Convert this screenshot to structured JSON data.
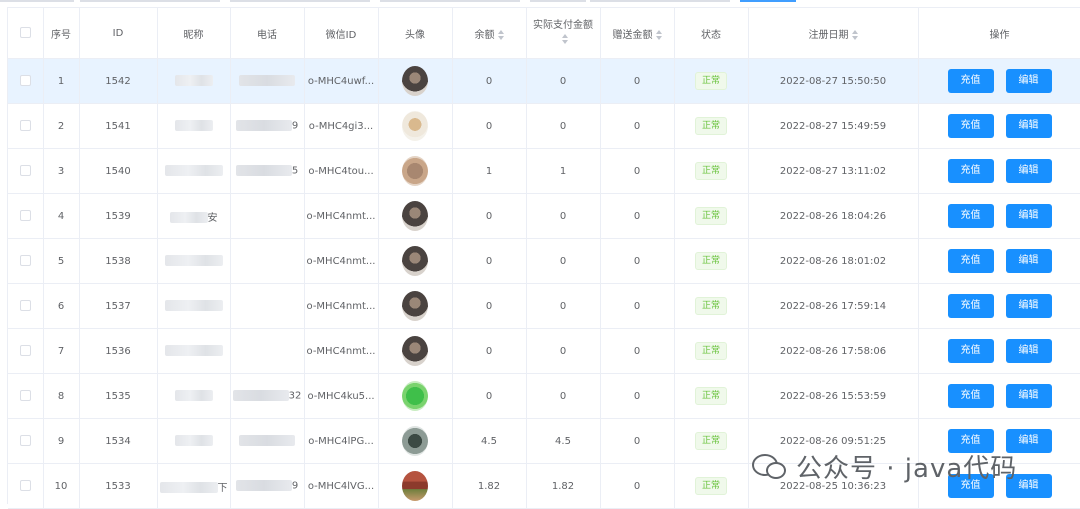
{
  "headers": {
    "index": "序号",
    "id": "ID",
    "nickname": "昵称",
    "phone": "电话",
    "wechat_id": "微信ID",
    "avatar": "头像",
    "balance": "余额",
    "paid_amount": "实际支付金额",
    "gift_amount": "赠送金额",
    "status": "状态",
    "reg_date": "注册日期",
    "actions": "操作"
  },
  "actions": {
    "recharge": "充值",
    "edit": "编辑"
  },
  "rows": [
    {
      "index": "1",
      "id": "1542",
      "wechat_id": "o-MHC4uwf...",
      "balance": "0",
      "paid": "0",
      "gift": "0",
      "status": "正常",
      "reg_date": "2022-08-27 15:50:50",
      "avatar_icon": "avatar-photo-icon"
    },
    {
      "index": "2",
      "id": "1541",
      "phone_tail": "9",
      "wechat_id": "o-MHC4gi3...",
      "balance": "0",
      "paid": "0",
      "gift": "0",
      "status": "正常",
      "reg_date": "2022-08-27 15:49:59",
      "avatar_icon": "avatar-photo-icon"
    },
    {
      "index": "3",
      "id": "1540",
      "phone_tail": "5",
      "wechat_id": "o-MHC4tou...",
      "balance": "1",
      "paid": "1",
      "gift": "0",
      "status": "正常",
      "reg_date": "2022-08-27 13:11:02",
      "avatar_icon": "avatar-photo-icon"
    },
    {
      "index": "4",
      "id": "1539",
      "nick_tail": "安",
      "wechat_id": "o-MHC4nmt...",
      "balance": "0",
      "paid": "0",
      "gift": "0",
      "status": "正常",
      "reg_date": "2022-08-26 18:04:26",
      "avatar_icon": "avatar-photo-icon"
    },
    {
      "index": "5",
      "id": "1538",
      "wechat_id": "o-MHC4nmt...",
      "balance": "0",
      "paid": "0",
      "gift": "0",
      "status": "正常",
      "reg_date": "2022-08-26 18:01:02",
      "avatar_icon": "avatar-photo-icon"
    },
    {
      "index": "6",
      "id": "1537",
      "wechat_id": "o-MHC4nmt...",
      "balance": "0",
      "paid": "0",
      "gift": "0",
      "status": "正常",
      "reg_date": "2022-08-26 17:59:14",
      "avatar_icon": "avatar-photo-icon"
    },
    {
      "index": "7",
      "id": "1536",
      "wechat_id": "o-MHC4nmt...",
      "balance": "0",
      "paid": "0",
      "gift": "0",
      "status": "正常",
      "reg_date": "2022-08-26 17:58:06",
      "avatar_icon": "avatar-photo-icon"
    },
    {
      "index": "8",
      "id": "1535",
      "phone_tail": "32",
      "wechat_id": "o-MHC4ku5...",
      "balance": "0",
      "paid": "0",
      "gift": "0",
      "status": "正常",
      "reg_date": "2022-08-26 15:53:59",
      "avatar_icon": "avatar-photo-icon"
    },
    {
      "index": "9",
      "id": "1534",
      "wechat_id": "o-MHC4lPG...",
      "balance": "4.5",
      "paid": "4.5",
      "gift": "0",
      "status": "正常",
      "reg_date": "2022-08-26 09:51:25",
      "avatar_icon": "avatar-photo-icon"
    },
    {
      "index": "10",
      "id": "1533",
      "nick_tail": "下",
      "phone_tail": "9",
      "wechat_id": "o-MHC4lVG...",
      "balance": "1.82",
      "paid": "1.82",
      "gift": "0",
      "status": "正常",
      "reg_date": "2022-08-25 10:36:23",
      "avatar_icon": "avatar-photo-icon"
    }
  ],
  "watermark": {
    "text": "公众号 · java代码",
    "icon": "wechat-logo-icon"
  },
  "colors": {
    "primary": "#1890ff",
    "success_text": "#67c23a",
    "success_bg": "#f0f9eb",
    "row_highlight": "#e8f3ff"
  }
}
